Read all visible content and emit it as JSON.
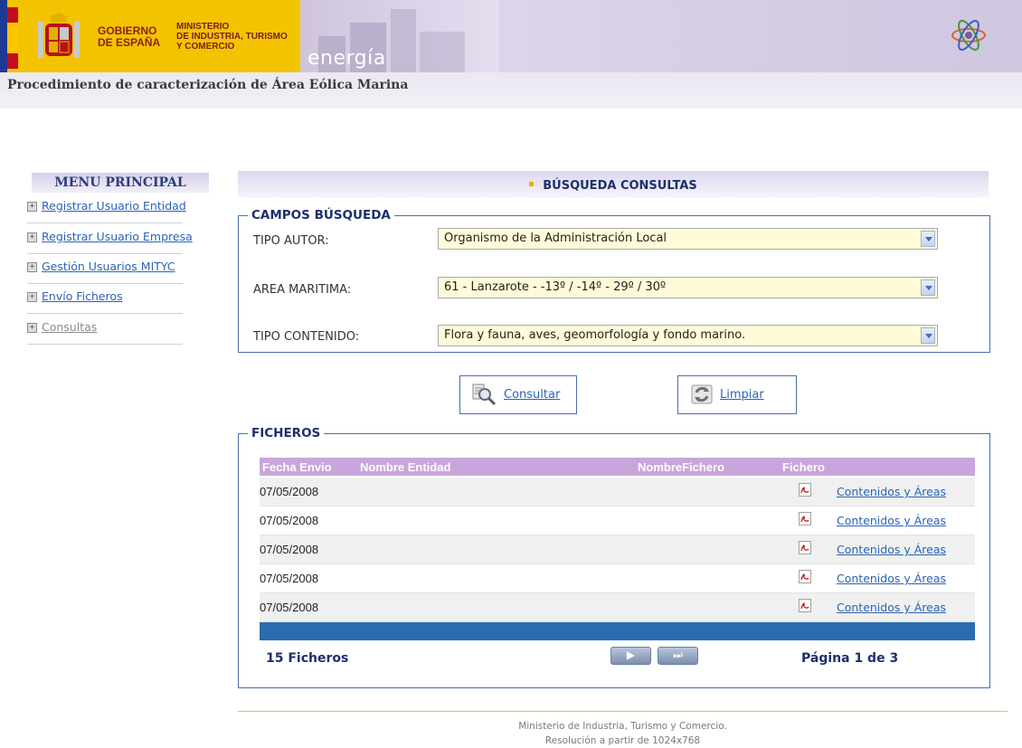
{
  "header": {
    "gov_line1": "GOBIERNO",
    "gov_line2": "DE ESPAÑA",
    "min_line1": "MINISTERIO",
    "min_line2": "DE INDUSTRIA, TURISMO",
    "min_line3": "Y COMERCIO",
    "energia": "energía",
    "title": "Procedimiento de caracterización de Área Eólica Marina"
  },
  "sidebar": {
    "title": "MENU PRINCIPAL",
    "items": [
      {
        "label": "Registrar Usuario Entidad"
      },
      {
        "label": "Registrar Usuario Empresa"
      },
      {
        "label": "Gestión Usuarios MITYC"
      },
      {
        "label": "Envío Ficheros"
      },
      {
        "label": "Consultas"
      }
    ]
  },
  "main": {
    "heading": "BÚSQUEDA CONSULTAS",
    "search": {
      "legend": "CAMPOS BÚSQUEDA",
      "tipo_autor_label": "TIPO AUTOR:",
      "tipo_autor_value": "Organismo de la Administración Local",
      "area_label": "AREA MARITIMA:",
      "area_value": "61 - Lanzarote - -13º / -14º - 29º / 30º",
      "contenido_label": "TIPO CONTENIDO:",
      "contenido_value": "Flora y fauna, aves, geomorfología y fondo marino."
    },
    "buttons": {
      "consultar": "Consultar",
      "limpiar": "Limpiar"
    },
    "files": {
      "legend": "FICHEROS",
      "columns": [
        "Fecha Envio",
        "Nombre Entidad",
        "NombreFichero",
        "Fichero"
      ],
      "rows": [
        {
          "date": "07/05/2008",
          "link": "Contenidos y Áreas"
        },
        {
          "date": "07/05/2008",
          "link": "Contenidos y Áreas"
        },
        {
          "date": "07/05/2008",
          "link": "Contenidos y Áreas"
        },
        {
          "date": "07/05/2008",
          "link": "Contenidos y Áreas"
        },
        {
          "date": "07/05/2008",
          "link": "Contenidos y Áreas"
        }
      ],
      "count": "15 Ficheros",
      "page": "Página 1 de 3",
      "next_symbol": "▶",
      "last_symbol": "⏭"
    }
  },
  "footer": {
    "line1": "Ministerio de Industria, Turismo y Comercio.",
    "line2": "Resolución a partir de 1024x768"
  },
  "colors": {
    "gov_yellow": "#f4c300",
    "link_blue": "#2a63b5",
    "heading_navy": "#1f2f6b",
    "table_header": "#c8a6dc",
    "table_footer": "#2b6cb0",
    "select_bg": "#fffbd8"
  }
}
